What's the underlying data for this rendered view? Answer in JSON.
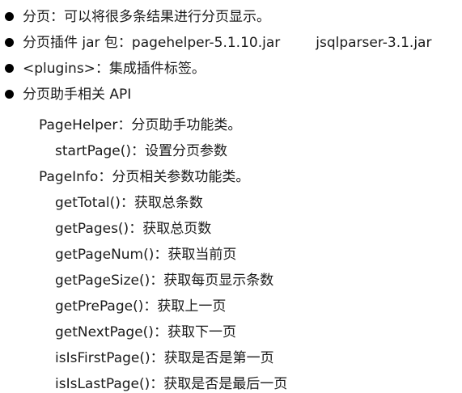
{
  "bullets": [
    {
      "text": "分页：可以将很多条结果进行分页显示。"
    },
    {
      "text": "分页插件 jar 包：pagehelper-5.1.10.jar",
      "extra": "jsqlparser-3.1.jar"
    },
    {
      "text": "<plugins>：集成插件标签。"
    },
    {
      "text": "分页助手相关 API"
    }
  ],
  "api": {
    "pagehelper": {
      "title": "PageHelper：分页助手功能类。",
      "methods": [
        "startPage()：设置分页参数"
      ]
    },
    "pageinfo": {
      "title": "PageInfo：分页相关参数功能类。",
      "methods": [
        "getTotal()：获取总条数",
        "getPages()：获取总页数",
        "getPageNum()：获取当前页",
        "getPageSize()：获取每页显示条数",
        "getPrePage()：获取上一页",
        "getNextPage()：获取下一页",
        "isIsFirstPage()：获取是否是第一页",
        "isIsLastPage()：获取是否是最后一页"
      ]
    }
  }
}
